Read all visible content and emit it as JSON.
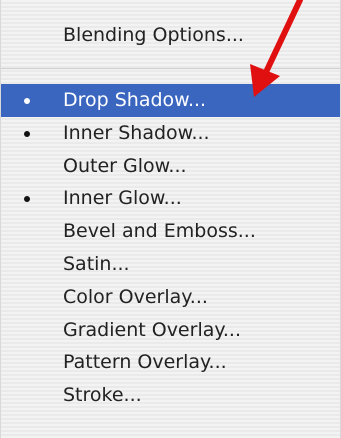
{
  "menu": {
    "blending_options": "Blending Options...",
    "items": [
      {
        "label": "Drop Shadow...",
        "checked": true,
        "selected": true
      },
      {
        "label": "Inner Shadow...",
        "checked": true,
        "selected": false
      },
      {
        "label": "Outer Glow...",
        "checked": false,
        "selected": false
      },
      {
        "label": "Inner Glow...",
        "checked": true,
        "selected": false
      },
      {
        "label": "Bevel and Emboss...",
        "checked": false,
        "selected": false
      },
      {
        "label": "Satin...",
        "checked": false,
        "selected": false
      },
      {
        "label": "Color Overlay...",
        "checked": false,
        "selected": false
      },
      {
        "label": "Gradient Overlay...",
        "checked": false,
        "selected": false
      },
      {
        "label": "Pattern Overlay...",
        "checked": false,
        "selected": false
      },
      {
        "label": "Stroke...",
        "checked": false,
        "selected": false
      }
    ]
  },
  "colors": {
    "highlight": "#3a66c0",
    "arrow": "#e01010"
  },
  "icons": {
    "pointer": "red-arrow-icon"
  }
}
